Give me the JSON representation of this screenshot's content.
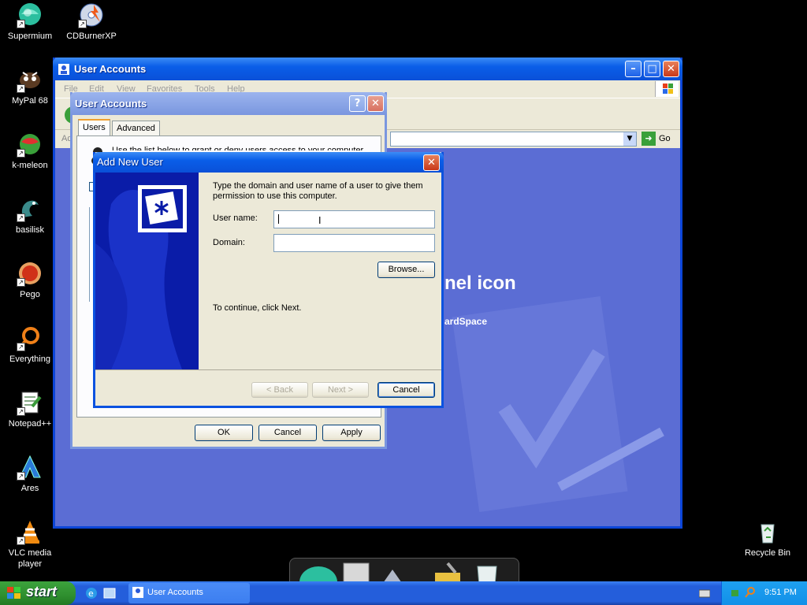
{
  "desktop": {
    "icons": [
      {
        "label": "Supermium",
        "icon": "supermium-icon"
      },
      {
        "label": "CDBurnerXP",
        "icon": "cdburnerxp-icon"
      },
      {
        "label": "MyPal 68",
        "icon": "mypal-icon"
      },
      {
        "label": "k-meleon",
        "icon": "kmeleon-icon"
      },
      {
        "label": "basilisk",
        "icon": "basilisk-icon"
      },
      {
        "label": "Pego",
        "icon": "pego-icon"
      },
      {
        "label": "Everything",
        "icon": "everything-icon"
      },
      {
        "label": "Notepad++",
        "icon": "notepadpp-icon"
      },
      {
        "label": "Ares",
        "icon": "ares-icon"
      },
      {
        "label": "VLC media player",
        "icon": "vlc-icon"
      },
      {
        "label": "Recycle Bin",
        "icon": "recycle-bin-icon"
      }
    ]
  },
  "control_panel_window": {
    "title": "User Accounts",
    "menu": [
      "File",
      "Edit",
      "View",
      "Favorites",
      "Tools",
      "Help"
    ],
    "address_label": "Ad",
    "go_label": "Go",
    "content_heading_fragment": "nel icon",
    "content_link_fragment": "ardSpace"
  },
  "user_accounts_dialog": {
    "title": "User Accounts",
    "help_glyph": "?",
    "tabs": [
      "Users",
      "Advanced"
    ],
    "buttons": {
      "ok": "OK",
      "cancel": "Cancel",
      "apply": "Apply"
    },
    "partial_text": "Use the list below to grant or deny users access to your computer"
  },
  "add_new_user_dialog": {
    "title": "Add New User",
    "instruction": "Type the domain and user name of a user to give them permission to use this computer.",
    "user_name_label": "User name:",
    "user_name_value": "",
    "domain_label": "Domain:",
    "domain_value": "",
    "browse_label": "Browse...",
    "continue_text": "To continue, click Next.",
    "back_label": "< Back",
    "next_label": "Next >",
    "cancel_label": "Cancel"
  },
  "taskbar": {
    "start_label": "start",
    "active_task": "User Accounts",
    "clock": "9:51 PM"
  },
  "colors": {
    "xp_blue": "#245edb",
    "title_blue": "#0a5ee8",
    "dialog_face": "#ece9d8",
    "content_blue": "#5b6dd4",
    "start_green": "#2f8f2f"
  }
}
